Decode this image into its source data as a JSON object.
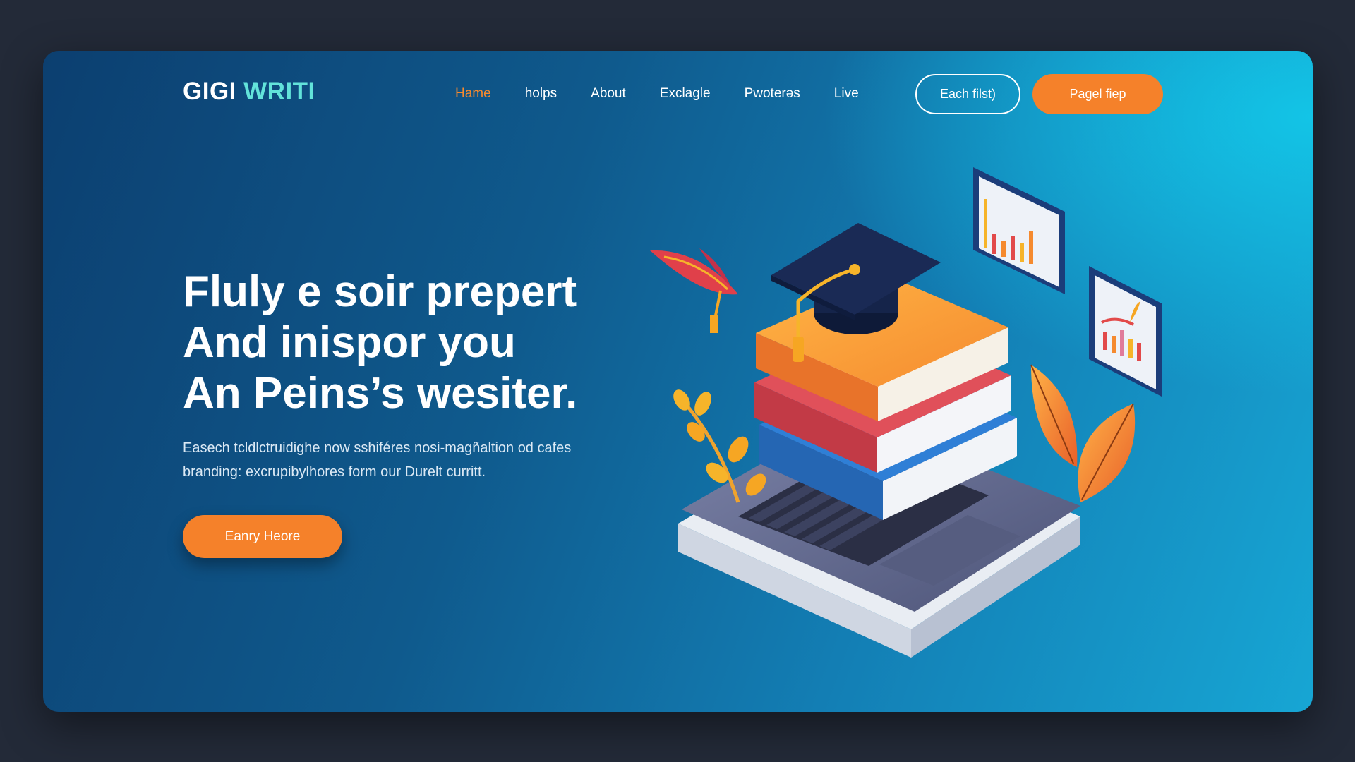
{
  "brand": {
    "name_main": "GIGI",
    "name_accent": "WRITI"
  },
  "nav": {
    "items": [
      {
        "label": "Hame",
        "active": true
      },
      {
        "label": "holps",
        "active": false
      },
      {
        "label": "About",
        "active": false
      },
      {
        "label": "Exclagle",
        "active": false
      },
      {
        "label": "Pwoterǝs",
        "active": false
      },
      {
        "label": "Live",
        "active": false
      }
    ]
  },
  "header_buttons": {
    "outline_label": "Each filst)",
    "primary_label": "Pagel fiep"
  },
  "hero": {
    "title_lines": [
      "Fluly e soir prepert",
      "And inispor you",
      "An Peins’s wesiter."
    ],
    "subtitle_lines": [
      "Easech tcldlctruidighe now sshiféres nosi-magñaltion od cafes",
      "branding: excrupibylhores form our  Durelt curritt."
    ],
    "cta_label": "Eanry Heore"
  },
  "colors": {
    "accent_orange": "#f5812a",
    "brand_teal": "#62e3da",
    "background_dark": "#232a38",
    "card_gradient_start": "#0c3f70",
    "card_gradient_end": "#17a6d4"
  },
  "illustration": {
    "icons": [
      "graduation-cap-icon",
      "book-stack-icon",
      "laptop-icon",
      "chart-frame-icon",
      "leaf-icon",
      "feather-quill-icon",
      "branch-icon"
    ]
  }
}
